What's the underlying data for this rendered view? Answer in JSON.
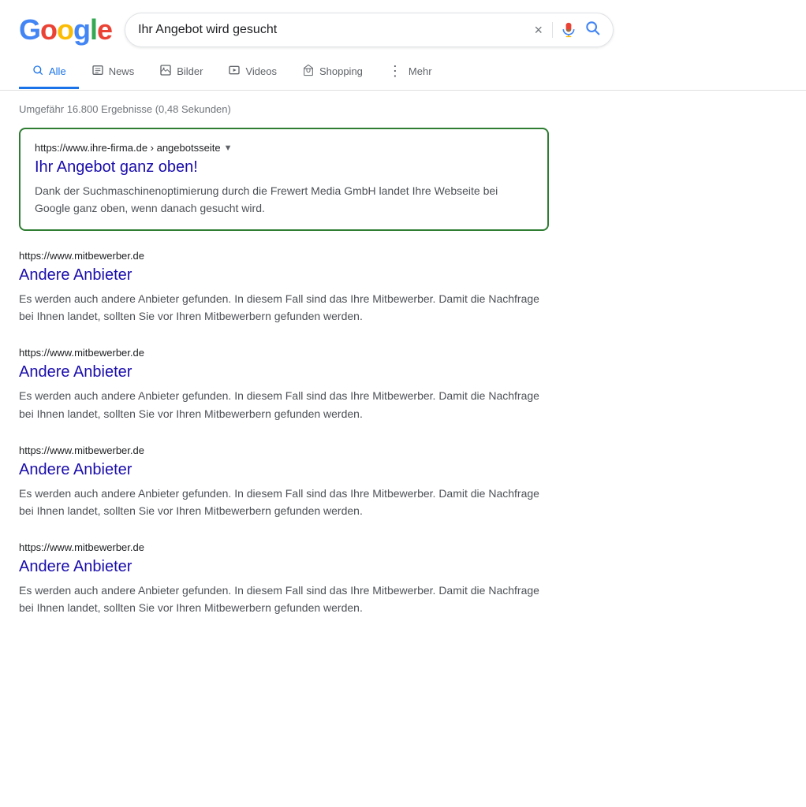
{
  "header": {
    "logo": {
      "g1": "G",
      "o1": "o",
      "o2": "o",
      "g2": "g",
      "l": "l",
      "e": "e"
    },
    "search": {
      "query": "Ihr Angebot wird gesucht",
      "clear_label": "×",
      "mic_label": "Spracheingabe",
      "search_label": "Suche"
    }
  },
  "nav": {
    "tabs": [
      {
        "id": "alle",
        "label": "Alle",
        "active": true,
        "icon": "🔍"
      },
      {
        "id": "news",
        "label": "News",
        "active": false,
        "icon": "📰"
      },
      {
        "id": "bilder",
        "label": "Bilder",
        "active": false,
        "icon": "🖼"
      },
      {
        "id": "videos",
        "label": "Videos",
        "active": false,
        "icon": "▶"
      },
      {
        "id": "shopping",
        "label": "Shopping",
        "active": false,
        "icon": "◇"
      },
      {
        "id": "mehr",
        "label": "Mehr",
        "active": false,
        "icon": "⋮"
      }
    ]
  },
  "results": {
    "count_text": "Umgefähr 16.800 Ergebnisse (0,48 Sekunden)",
    "featured": {
      "url": "https://www.ihre-firma.de › angebotsseite",
      "title": "Ihr Angebot ganz oben!",
      "description": "Dank der Suchmaschinenoptimierung durch die Frewert Media GmbH landet Ihre Webseite bei Google ganz oben, wenn danach gesucht wird."
    },
    "items": [
      {
        "url": "https://www.mitbewerber.de",
        "title": "Andere Anbieter",
        "description": "Es werden auch andere Anbieter gefunden. In diesem Fall sind das Ihre Mitbewerber. Damit die Nachfrage bei Ihnen landet, sollten Sie vor Ihren Mitbewerbern gefunden werden."
      },
      {
        "url": "https://www.mitbewerber.de",
        "title": "Andere Anbieter",
        "description": "Es werden auch andere Anbieter gefunden. In diesem Fall sind das Ihre Mitbewerber. Damit die Nachfrage bei Ihnen landet, sollten Sie vor Ihren Mitbewerbern gefunden werden."
      },
      {
        "url": "https://www.mitbewerber.de",
        "title": "Andere Anbieter",
        "description": "Es werden auch andere Anbieter gefunden. In diesem Fall sind das Ihre Mitbewerber. Damit die Nachfrage bei Ihnen landet, sollten Sie vor Ihren Mitbewerbern gefunden werden."
      },
      {
        "url": "https://www.mitbewerber.de",
        "title": "Andere Anbieter",
        "description": "Es werden auch andere Anbieter gefunden. In diesem Fall sind das Ihre Mitbewerber. Damit die Nachfrage bei Ihnen landet, sollten Sie vor Ihren Mitbewerbern gefunden werden."
      }
    ]
  },
  "colors": {
    "google_blue": "#4285F4",
    "google_red": "#EA4335",
    "google_yellow": "#FBBC05",
    "google_green": "#34A853",
    "featured_border": "#2e7d32",
    "link_color": "#1a0dab",
    "active_tab": "#1a73e8"
  }
}
